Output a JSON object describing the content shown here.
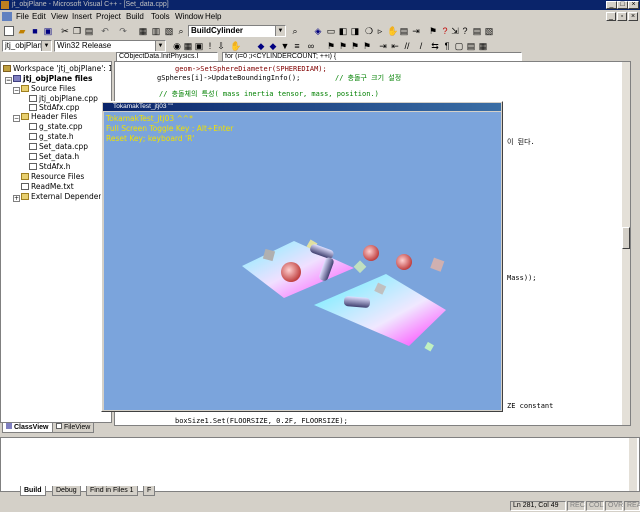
{
  "app": {
    "title": "jt_objPlane - Microsoft Visual C++ - [Set_data.cpp]"
  },
  "menu": {
    "items": [
      "File",
      "Edit",
      "View",
      "Insert",
      "Project",
      "Build",
      "Tools",
      "Window",
      "Help"
    ]
  },
  "toolbar": {
    "find_combo": "BuildCylinder",
    "project_combo": "jtj_objPlane",
    "config_combo": "Win32 Release"
  },
  "editor_bar": {
    "class_combo": "CObjectData.InitPhysics.I",
    "member_combo": "for (i=0 ;i<CYLINDERCOUNT; ++i) {"
  },
  "workspace": {
    "root": "Workspace 'jtj_objPlane': 1",
    "project": "jtj_objPlane files",
    "source_folder": "Source Files",
    "source_files": [
      "jtj_objPlane.cpp",
      "StdAfx.cpp"
    ],
    "header_folder": "Header Files",
    "header_files": [
      "g_state.cpp",
      "g_state.h",
      "Set_data.cpp",
      "Set_data.h",
      "StdAfx.h"
    ],
    "resource_folder": "Resource Files",
    "readme": "ReadMe.txt",
    "external": "External Dependen",
    "tabs": [
      "ClassView",
      "FileView"
    ]
  },
  "code": {
    "line1": "geom->SetSphereDiameter(SPHEREDIAM);",
    "line2": "gSpheres[i]->UpdateBoundingInfo();",
    "line2_comment": "// 충돌구 크기 설정",
    "line3": "// 충돌체의 특성( mass inertia tensor, mass, position.)",
    "fragment_right1": "이 된다.",
    "fragment_right2": "Mass));",
    "fragment_right3": "ZE constant",
    "line_last1": "boxSize1.Set(FLOORSIZE, 0.2F, FLOORSIZE);"
  },
  "game": {
    "title": "TokamakTest_jtj03 \"\"",
    "line1": "TokamakTest_jtj03 ^^*",
    "line2": "Full Screen Toggle Key ; Alt+Enter",
    "line3": "Reset Key; keyboard 'R'"
  },
  "output": {
    "tabs": [
      "Build",
      "Debug",
      "Find in Files 1",
      "F"
    ]
  },
  "status": {
    "position": "Ln 281, Col 49",
    "rec": "REC",
    "col": "COL",
    "ovr": "OVR",
    "read": "READ"
  },
  "colors": {
    "scene_bg": "#7ba4dc",
    "overlay_text": "#f0e000",
    "title_bar": "#0a246a"
  }
}
